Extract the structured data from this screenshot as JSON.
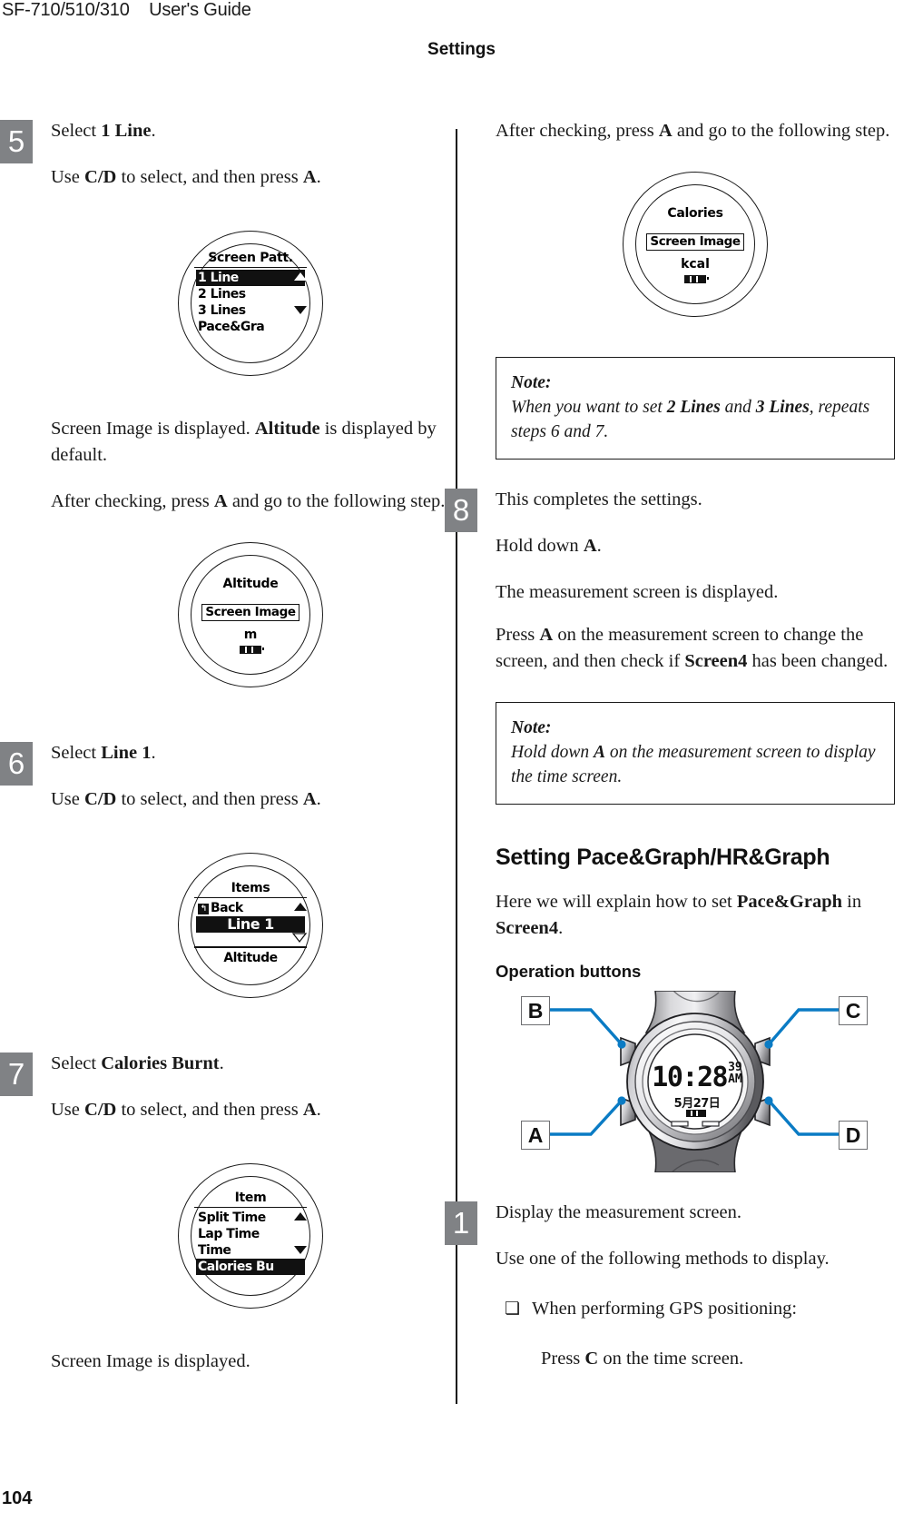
{
  "header": {
    "model": "SF-710/510/310",
    "guide": "User's Guide",
    "chapter": "Settings"
  },
  "page_number": "104",
  "left_column": {
    "step5": {
      "number": "5",
      "line1_prefix": "Select ",
      "line1_bold": "1 Line",
      "line1_suffix": ".",
      "line2_prefix": "Use ",
      "line2_bold1": "C/D",
      "line2_mid": " to select, and then press ",
      "line2_bold2": "A",
      "line2_suffix": ".",
      "watch1": {
        "title": "Screen Patt.",
        "items": [
          "1 Line",
          "2 Lines",
          "3 Lines",
          "Pace&Gra"
        ],
        "selected_index": 0,
        "arrow_up": "up-arrow",
        "arrow_down": "down-arrow"
      },
      "para1_prefix": "Screen Image is displayed. ",
      "para1_bold": "Altitude",
      "para1_suffix": " is displayed by default.",
      "para2_prefix": "After checking, press ",
      "para2_bold": "A",
      "para2_suffix": " and go to the following step.",
      "watch2": {
        "title": "Altitude",
        "boxed": "Screen Image",
        "unit": "m"
      }
    },
    "step6": {
      "number": "6",
      "line1_prefix": "Select ",
      "line1_bold": "Line 1",
      "line1_suffix": ".",
      "line2_prefix": "Use ",
      "line2_bold1": "C/D",
      "line2_mid": " to select, and then press ",
      "line2_bold2": "A",
      "line2_suffix": ".",
      "watch": {
        "title": "Items",
        "back_label": "Back",
        "back_icon": "return-arrow-icon",
        "items": [
          "Line 1",
          "Altitude"
        ],
        "selected_index": 0
      }
    },
    "step7": {
      "number": "7",
      "line1_prefix": "Select ",
      "line1_bold": "Calories Burnt",
      "line1_suffix": ".",
      "line2_prefix": "Use ",
      "line2_bold1": "C/D",
      "line2_mid": " to select, and then press ",
      "line2_bold2": "A",
      "line2_suffix": ".",
      "watch": {
        "title": "Item",
        "items": [
          "Split Time",
          "Lap Time",
          "Time",
          "Calories Bu"
        ],
        "selected_index": 3
      },
      "closing": "Screen Image is displayed."
    }
  },
  "right_column": {
    "intro": {
      "para_prefix": "After checking, press ",
      "para_bold": "A",
      "para_suffix": " and go to the following step.",
      "watch": {
        "title": "Calories",
        "boxed": "Screen Image",
        "unit": "kcal"
      }
    },
    "note1": {
      "label": "Note:",
      "text_prefix": "When you want to set ",
      "text_bold1": "2 Lines",
      "text_mid": " and ",
      "text_bold2": "3 Lines",
      "text_suffix": ", repeats steps 6 and 7."
    },
    "step8": {
      "number": "8",
      "line1": "This completes the settings.",
      "line2_prefix": "Hold down ",
      "line2_bold": "A",
      "line2_suffix": ".",
      "line3": "The measurement screen is displayed.",
      "line4_prefix": "Press ",
      "line4_bold1": "A",
      "line4_mid": " on the measurement screen to change the screen, and then check if ",
      "line4_bold2": "Screen4",
      "line4_suffix": " has been changed."
    },
    "note2": {
      "label": "Note:",
      "text_prefix": "Hold down ",
      "text_bold": "A",
      "text_suffix": " on the measurement screen to display the time screen."
    },
    "section": {
      "title": "Setting Pace&Graph/HR&Graph",
      "intro_prefix": "Here we will explain how to set ",
      "intro_bold1": "Pace&Graph",
      "intro_mid": " in ",
      "intro_bold2": "Screen4",
      "intro_suffix": ".",
      "subtitle": "Operation buttons"
    },
    "product_figure": {
      "label_b": "B",
      "label_c": "C",
      "label_a": "A",
      "label_d": "D",
      "lcd_time": "10:28",
      "lcd_seconds": "39",
      "lcd_ampm": "AM",
      "lcd_date": "5月27日",
      "callout_color": "#0a7bc4"
    },
    "step1": {
      "number": "1",
      "line1": "Display the measurement screen.",
      "line2": "Use one of the following methods to display.",
      "bullet_mark": "❏",
      "bullet1": "When performing GPS positioning:",
      "bullet1_sub_prefix": "Press ",
      "bullet1_sub_bold": "C",
      "bullet1_sub_suffix": " on the time screen."
    }
  }
}
